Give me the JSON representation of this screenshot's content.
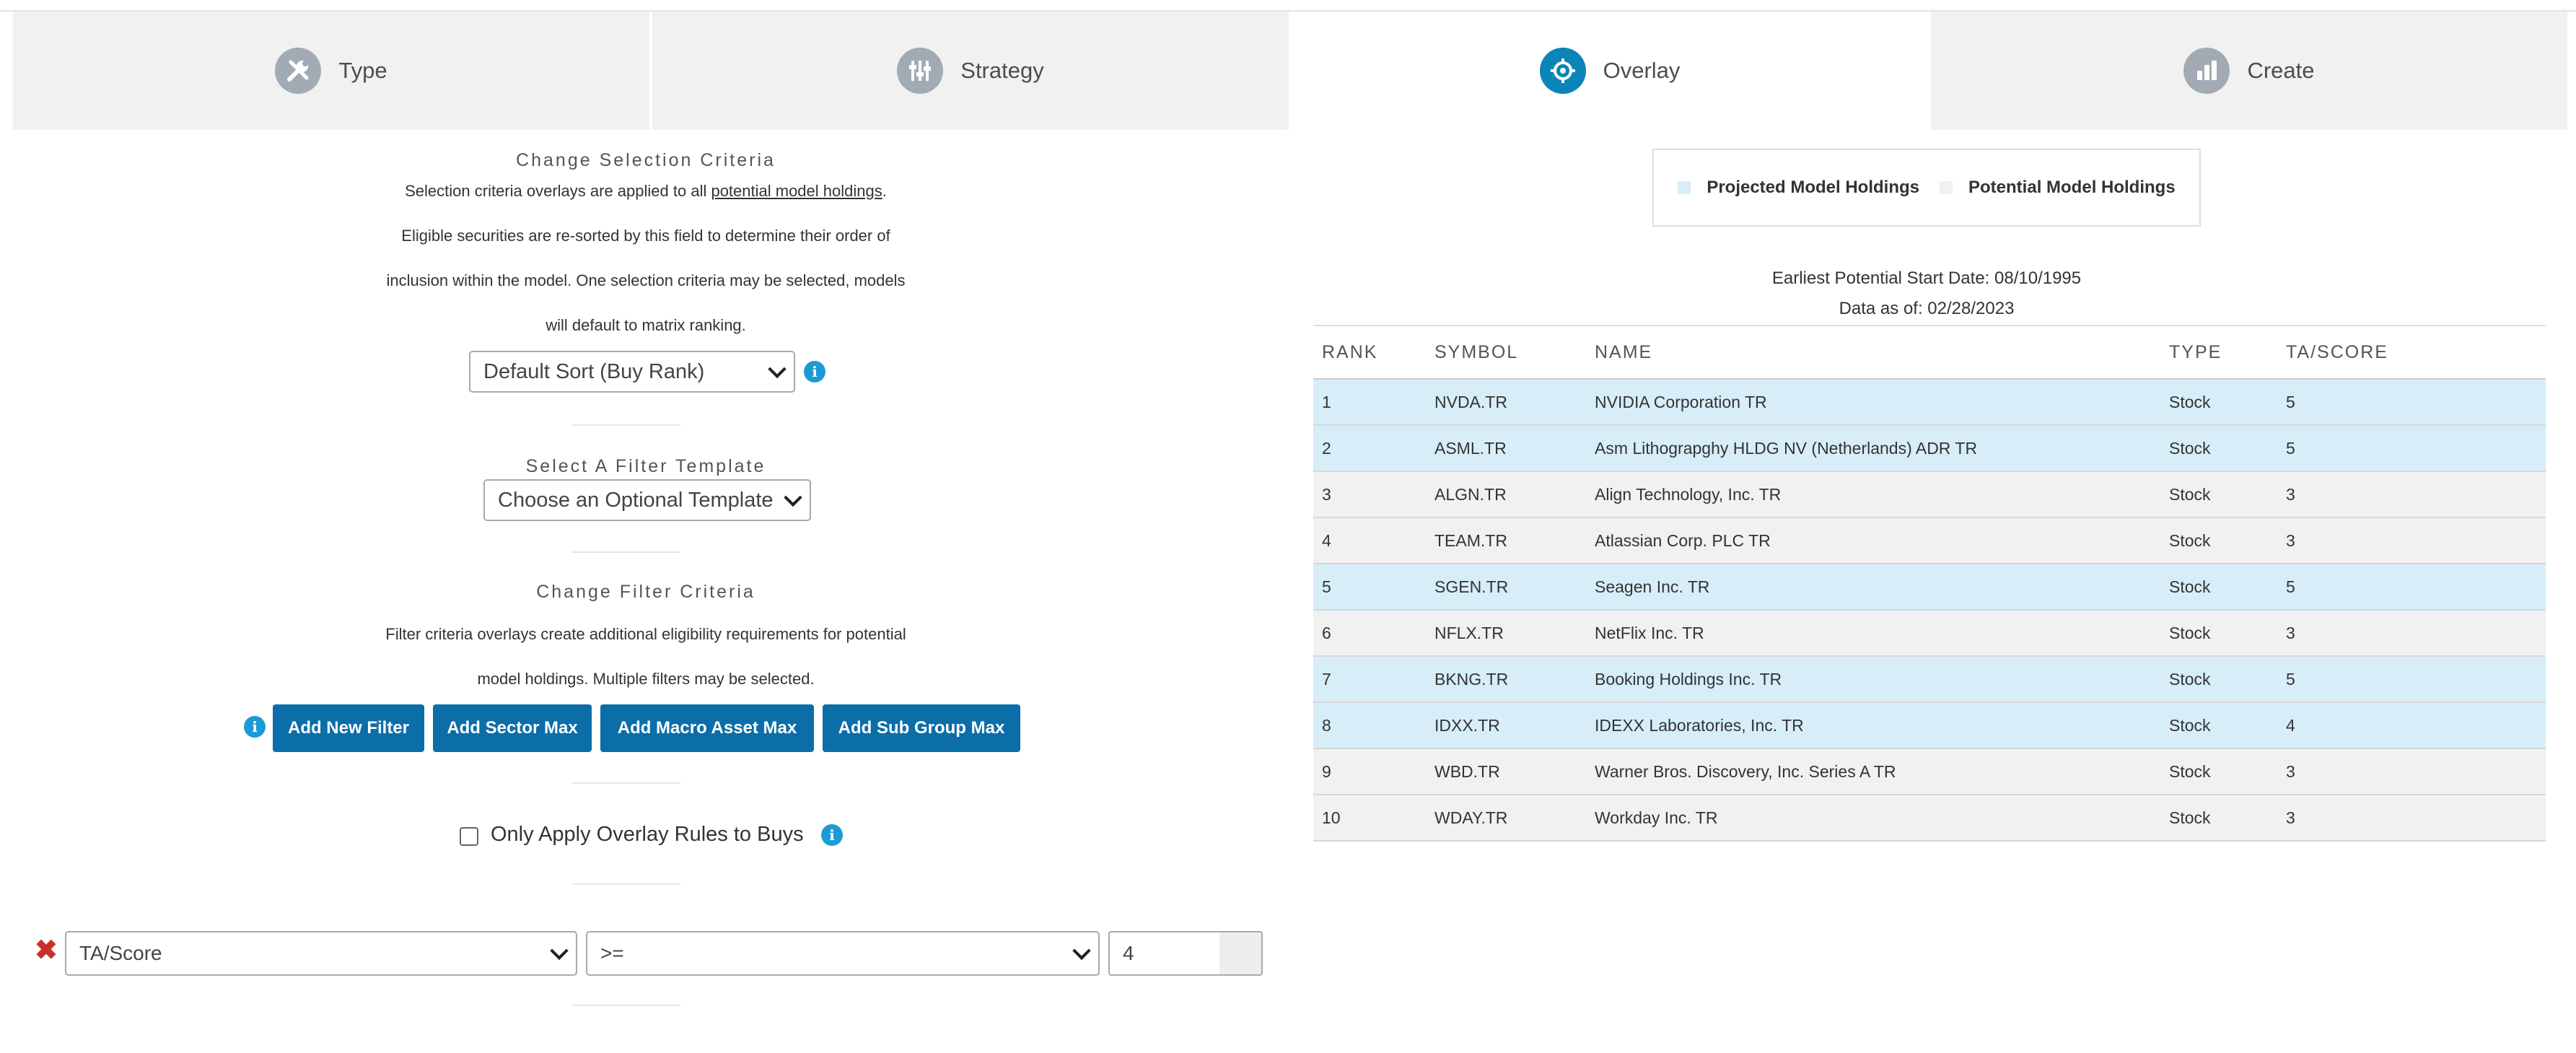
{
  "tabs": [
    {
      "label": "Type",
      "icon": "wrench-icon",
      "active": false
    },
    {
      "label": "Strategy",
      "icon": "sliders-icon",
      "active": false
    },
    {
      "label": "Overlay",
      "icon": "overlay-icon",
      "active": true
    },
    {
      "label": "Create",
      "icon": "bar-chart-icon",
      "active": false
    }
  ],
  "selection": {
    "title": "Change Selection Criteria",
    "line1_pre": "Selection criteria overlays are applied to all ",
    "line1_link": "potential model holdings",
    "line1_post": ".",
    "line2": "Eligible securities are re-sorted by this field to determine their order of",
    "line3": "inclusion within the model. One selection criteria may be selected, models",
    "line4": "will default to matrix ranking.",
    "sort_value": "Default Sort (Buy Rank)"
  },
  "template": {
    "title": "Select A Filter Template",
    "value": "Choose an Optional Template"
  },
  "filter": {
    "title": "Change Filter Criteria",
    "line1": "Filter criteria overlays create additional eligibility requirements for potential",
    "line2": "model holdings. Multiple filters may be selected.",
    "buttons": {
      "add_new_filter": "Add New Filter",
      "add_sector_max": "Add Sector Max",
      "add_macro_asset_max": "Add Macro Asset Max",
      "add_sub_group_max": "Add Sub Group Max"
    }
  },
  "overlay_rules": {
    "label": "Only Apply Overlay Rules to Buys",
    "checked": false
  },
  "filter_row": {
    "field": "TA/Score",
    "operator": ">=",
    "value": "4"
  },
  "legend": {
    "projected": "Projected Model Holdings",
    "potential": "Potential Model Holdings"
  },
  "meta": {
    "start_date": "Earliest Potential Start Date: 08/10/1995",
    "data_as_of": "Data as of: 02/28/2023"
  },
  "table": {
    "headers": {
      "rank": "RANK",
      "symbol": "SYMBOL",
      "name": "NAME",
      "type": "TYPE",
      "score": "TA/SCORE"
    },
    "rows": [
      {
        "rank": "1",
        "symbol": "NVDA.TR",
        "name": "NVIDIA Corporation TR",
        "type": "Stock",
        "score": "5",
        "projected": true
      },
      {
        "rank": "2",
        "symbol": "ASML.TR",
        "name": "Asm Lithograpghy HLDG NV (Netherlands) ADR TR",
        "type": "Stock",
        "score": "5",
        "projected": true
      },
      {
        "rank": "3",
        "symbol": "ALGN.TR",
        "name": "Align Technology, Inc. TR",
        "type": "Stock",
        "score": "3",
        "projected": false
      },
      {
        "rank": "4",
        "symbol": "TEAM.TR",
        "name": "Atlassian Corp. PLC TR",
        "type": "Stock",
        "score": "3",
        "projected": false
      },
      {
        "rank": "5",
        "symbol": "SGEN.TR",
        "name": "Seagen Inc. TR",
        "type": "Stock",
        "score": "5",
        "projected": true
      },
      {
        "rank": "6",
        "symbol": "NFLX.TR",
        "name": "NetFlix Inc. TR",
        "type": "Stock",
        "score": "3",
        "projected": false
      },
      {
        "rank": "7",
        "symbol": "BKNG.TR",
        "name": "Booking Holdings Inc. TR",
        "type": "Stock",
        "score": "5",
        "projected": true
      },
      {
        "rank": "8",
        "symbol": "IDXX.TR",
        "name": "IDEXX Laboratories, Inc. TR",
        "type": "Stock",
        "score": "4",
        "projected": true
      },
      {
        "rank": "9",
        "symbol": "WBD.TR",
        "name": "Warner Bros. Discovery, Inc. Series A TR",
        "type": "Stock",
        "score": "3",
        "projected": false
      },
      {
        "rank": "10",
        "symbol": "WDAY.TR",
        "name": "Workday Inc. TR",
        "type": "Stock",
        "score": "3",
        "projected": false
      }
    ]
  },
  "colors": {
    "accent": "#0b84b8",
    "button": "#0b6ea8",
    "projected_row": "#d7eef9",
    "potential_row": "#f1f1f1",
    "remove": "#c9302c"
  }
}
